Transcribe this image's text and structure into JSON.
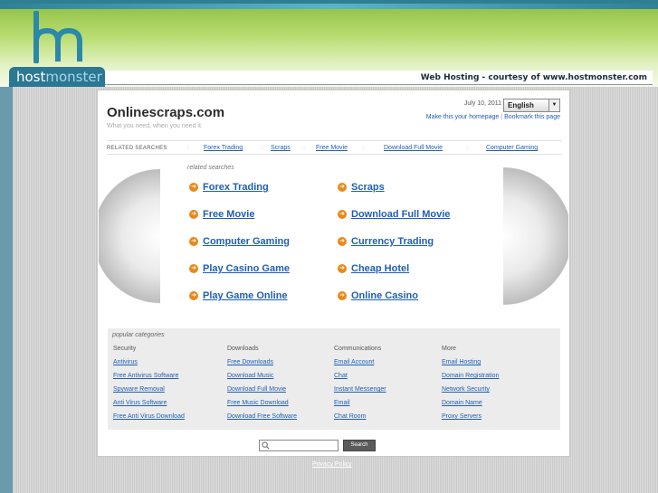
{
  "host": {
    "logo_part1": "host",
    "logo_part2": "monster",
    "courtesy": "Web Hosting - courtesy of www.hostmonster.com"
  },
  "site": {
    "title": "Onlinescraps.com",
    "tagline": "What you need, when you need it",
    "date": "July 10, 2011",
    "language": "English",
    "make_homepage": "Make this your homepage",
    "bookmark": "Bookmark this page"
  },
  "related_bar": {
    "label": "RELATED SEARCHES",
    "links": [
      "Forex Trading",
      "Scraps",
      "Free Movie",
      "Download Full Movie",
      "Computer Gaming"
    ]
  },
  "related_searches": {
    "heading": "related searches",
    "items": [
      "Forex Trading",
      "Scraps",
      "Free Movie",
      "Download Full Movie",
      "Computer Gaming",
      "Currency Trading",
      "Play Casino Game",
      "Cheap Hotel",
      "Play Game Online",
      "Online Casino"
    ]
  },
  "popular": {
    "heading": "popular categories",
    "columns": [
      {
        "title": "Security",
        "links": [
          "Antivirus",
          "Free Antivirus Software",
          "Spyware Removal",
          "Anti Virus Software",
          "Free Anti Virus Download"
        ]
      },
      {
        "title": "Downloads",
        "links": [
          "Free Downloads",
          "Download Music",
          "Download Full Movie",
          "Free Music Download",
          "Download Free Software"
        ]
      },
      {
        "title": "Communications",
        "links": [
          "Email Account",
          "Chat",
          "Instant Messenger",
          "Email",
          "Chat Room"
        ]
      },
      {
        "title": "More",
        "links": [
          "Email Hosting",
          "Domain Registration",
          "Network Security",
          "Domain Name",
          "Proxy Servers"
        ]
      }
    ]
  },
  "search": {
    "placeholder": "",
    "button": "Search"
  },
  "footer": {
    "privacy": "Privacy Policy"
  },
  "icons": {
    "bullet": "arrow-right-circle-icon",
    "search": "magnifier-icon"
  },
  "colors": {
    "link": "#1f5fb5",
    "bullet": "#e88a1a",
    "banner_green": "#8fc043",
    "logo_blue": "#2a7893"
  }
}
